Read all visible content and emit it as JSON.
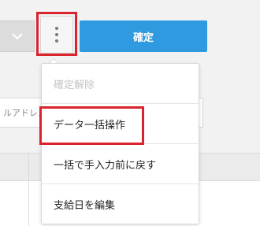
{
  "toolbar": {
    "confirm_label": "確定",
    "kebab_icon": "more-vertical-icon",
    "dropdown_icon": "chevron-down-icon"
  },
  "background": {
    "input_fragment": "ルアドレス"
  },
  "menu": {
    "items": [
      {
        "label": "確定解除",
        "disabled": true
      },
      {
        "label": "データ一括操作",
        "disabled": false
      },
      {
        "label": "一括で手入力前に戻す",
        "disabled": false
      },
      {
        "label": "支給日を編集",
        "disabled": false
      }
    ]
  },
  "colors": {
    "accent": "#2f9ae0",
    "highlight": "#d9232d",
    "disabled_text": "#c4c4c4"
  }
}
